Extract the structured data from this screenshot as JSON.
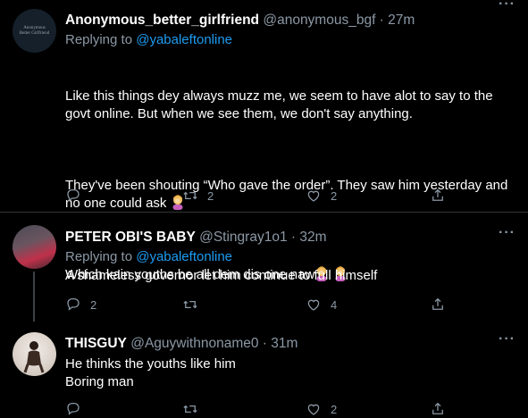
{
  "tweets": [
    {
      "name": "Anonymous_better_girlfriend",
      "handle": "@anonymous_bgf · 27m",
      "avatar_text": "Anonymous\nBetter Girlfriend",
      "replying_prefix": "Replying to ",
      "replying_to": "@yabaleftonline",
      "body_p1": "Like this things dey always muzz me, we seem to have alot to say to the govt online. But when we see them, we don't say anything.",
      "body_p2": "They've been shouting “Who gave the order”. They saw him yesterday and no one could ask",
      "body_p3": "Which kain youths be all dem dis one naw",
      "reply_count": "",
      "retweet_count": "2",
      "like_count": "2"
    },
    {
      "name": "PETER OBI'S BABY",
      "handle": "@Stingray1o1 · 32m",
      "replying_prefix": "Replying to ",
      "replying_to": "@yabaleftonline",
      "body": "A shameless governor let him continue to full himself",
      "reply_count": "2",
      "retweet_count": "",
      "like_count": "4"
    },
    {
      "name": "THISGUY",
      "handle": "@Aguywithnoname0 · 31m",
      "body": "He thinks the youths like him\nBoring man",
      "reply_count": "",
      "retweet_count": "",
      "like_count": "2"
    }
  ],
  "icons": {
    "reply": "reply-icon",
    "retweet": "retweet-icon",
    "like": "heart-icon",
    "share": "share-icon",
    "more": "more-icon",
    "emoji": "woman-facepalming-emoji"
  },
  "colors": {
    "background": "#000000",
    "accent": "#1d9bf0",
    "secondary_text": "#8b98a5"
  }
}
